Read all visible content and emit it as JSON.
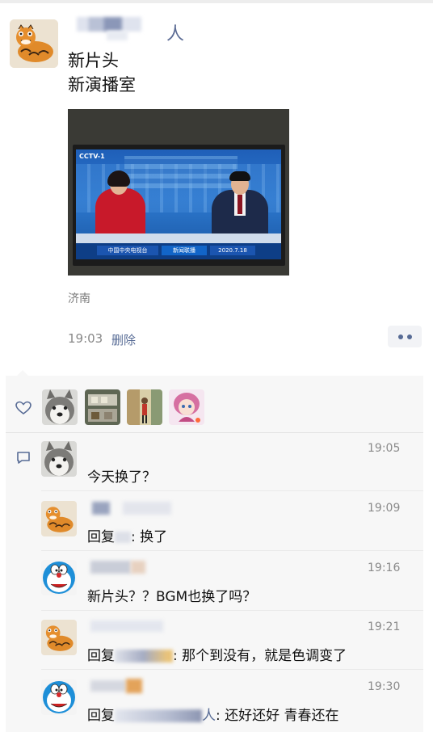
{
  "post": {
    "author_name_suffix": "人",
    "text_line1": "新片头",
    "text_line2": "新演播室",
    "photo": {
      "channel_logo": "CCTV-1",
      "ticker_left": "中国中央电视台",
      "ticker_mid": "新闻联播",
      "ticker_date": "2020.7.18"
    },
    "location": "济南",
    "time": "19:03",
    "delete_label": "删除"
  },
  "colors": {
    "link": "#576b95",
    "panel_bg": "#f7f7f7"
  },
  "icons": {
    "like": "heart-icon",
    "comment": "comment-icon",
    "more": "more-dots-icon"
  },
  "comments": [
    {
      "time": "19:05",
      "text": "今天换了？"
    },
    {
      "time": "19:09",
      "prefix": "回复",
      "text": ": 换了"
    },
    {
      "time": "19:16",
      "text": "新片头？？BGM也换了吗？"
    },
    {
      "time": "19:21",
      "prefix": "回复",
      "text": ": 那个到没有，就是色调变了"
    },
    {
      "time": "19:30",
      "prefix": "回复",
      "suffix": "人",
      "text": ": 还好还好 青春还在"
    }
  ]
}
